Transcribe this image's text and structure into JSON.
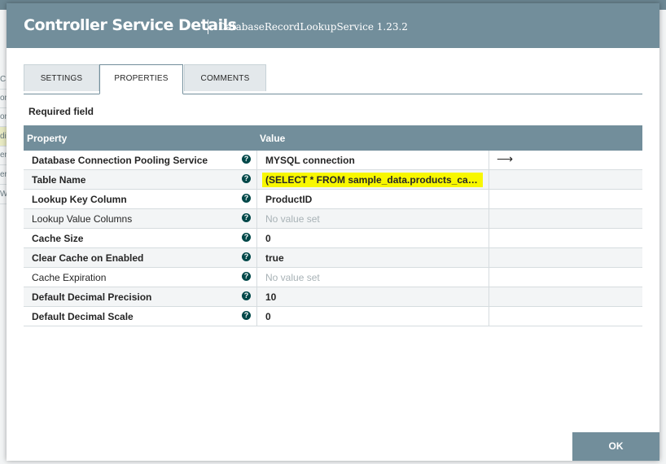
{
  "background": {
    "row_fragments": [
      "C",
      "on",
      "on",
      "di",
      "er",
      "er",
      "W"
    ]
  },
  "dialog": {
    "title": "Controller Service Details",
    "subtitle": "DatabaseRecordLookupService 1.23.2",
    "tabs": [
      {
        "label": "SETTINGS",
        "active": false
      },
      {
        "label": "PROPERTIES",
        "active": true
      },
      {
        "label": "COMMENTS",
        "active": false
      }
    ],
    "required_label": "Required field",
    "table": {
      "headers": {
        "property": "Property",
        "value": "Value"
      },
      "rows": [
        {
          "property": "Database Connection Pooling Service",
          "required": true,
          "value": "MYSQL connection",
          "empty": false,
          "highlight": false,
          "goto": true
        },
        {
          "property": "Table Name",
          "required": true,
          "value": "(SELECT * FROM sample_data.products_catalog) AS products",
          "empty": false,
          "highlight": true,
          "goto": false
        },
        {
          "property": "Lookup Key Column",
          "required": true,
          "value": "ProductID",
          "empty": false,
          "highlight": false,
          "goto": false
        },
        {
          "property": "Lookup Value Columns",
          "required": false,
          "value": "No value set",
          "empty": true,
          "highlight": false,
          "goto": false
        },
        {
          "property": "Cache Size",
          "required": true,
          "value": "0",
          "empty": false,
          "highlight": false,
          "goto": false
        },
        {
          "property": "Clear Cache on Enabled",
          "required": true,
          "value": "true",
          "empty": false,
          "highlight": false,
          "goto": false
        },
        {
          "property": "Cache Expiration",
          "required": false,
          "value": "No value set",
          "empty": true,
          "highlight": false,
          "goto": false
        },
        {
          "property": "Default Decimal Precision",
          "required": true,
          "value": "10",
          "empty": false,
          "highlight": false,
          "goto": false
        },
        {
          "property": "Default Decimal Scale",
          "required": true,
          "value": "0",
          "empty": false,
          "highlight": false,
          "goto": false
        }
      ],
      "help_icon": "help-circle-icon",
      "goto_icon": "arrow-right-icon",
      "help_glyph": "?",
      "goto_glyph": "⟶"
    },
    "ok_label": "OK",
    "colors": {
      "header": "#728e9b",
      "highlight": "#f8f700",
      "help": "#004849"
    }
  }
}
